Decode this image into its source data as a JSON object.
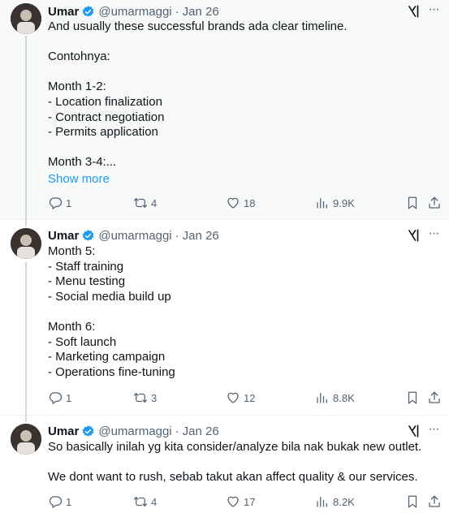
{
  "colors": {
    "link": "#1d9bf0",
    "secondary_text": "#536471",
    "verified_badge": "#1d9bf0",
    "highlighted_bg": "#f7f9f9"
  },
  "tweets": [
    {
      "author": {
        "name": "Umar",
        "handle": "@umarmaggi",
        "verified": true
      },
      "separator": "·",
      "date": "Jan 26",
      "text": "And usually these successful brands ada clear timeline.\n\nContohnya:\n\nMonth 1-2:\n- Location finalization\n- Contract negotiation\n- Permits application\n\nMonth 3-4:...",
      "show_more": "Show more",
      "stats": {
        "replies": "1",
        "reposts": "4",
        "likes": "18",
        "views": "9.9K"
      }
    },
    {
      "author": {
        "name": "Umar",
        "handle": "@umarmaggi",
        "verified": true
      },
      "separator": "·",
      "date": "Jan 26",
      "text": "Month 5:\n- Staff training\n- Menu testing\n- Social media build up\n\nMonth 6:\n- Soft launch\n- Marketing campaign\n- Operations fine-tuning",
      "stats": {
        "replies": "1",
        "reposts": "3",
        "likes": "12",
        "views": "8.8K"
      }
    },
    {
      "author": {
        "name": "Umar",
        "handle": "@umarmaggi",
        "verified": true
      },
      "separator": "·",
      "date": "Jan 26",
      "text": "So basically inilah yg kita consider/analyze bila nak bukak new outlet.\n\nWe dont want to rush, sebab takut akan affect quality & our services.",
      "stats": {
        "replies": "1",
        "reposts": "4",
        "likes": "17",
        "views": "8.2K"
      }
    }
  ],
  "icons": {
    "more": "more-icon",
    "grok": "grok-icon",
    "reply": "reply-icon",
    "repost": "repost-icon",
    "like": "like-icon",
    "views": "views-icon",
    "bookmark": "bookmark-icon",
    "share": "share-icon"
  }
}
